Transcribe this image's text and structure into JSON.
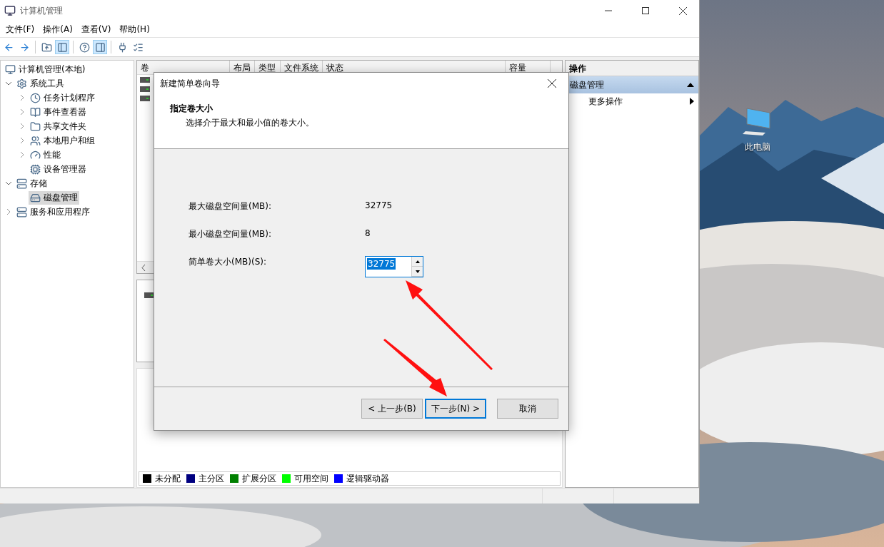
{
  "window": {
    "title": "计算机管理"
  },
  "menu": [
    "文件(F)",
    "操作(A)",
    "查看(V)",
    "帮助(H)"
  ],
  "toolbar": [
    {
      "pressed": false
    },
    {
      "pressed": false
    },
    {
      "pressed": false
    },
    {
      "pressed": true
    },
    {
      "pressed": false
    },
    {
      "pressed": true
    },
    {
      "pressed": false
    },
    {
      "pressed": false
    }
  ],
  "tree": {
    "label": "计算机管理(本地)",
    "children": [
      {
        "label": "系统工具",
        "expanded": true,
        "selected": false,
        "children": [
          {
            "label": "任务计划程序",
            "expanded": false,
            "selected": false
          },
          {
            "label": "事件查看器",
            "expanded": false,
            "selected": false
          },
          {
            "label": "共享文件夹",
            "expanded": false,
            "selected": false
          },
          {
            "label": "本地用户和组",
            "expanded": false,
            "selected": false
          },
          {
            "label": "性能",
            "expanded": false,
            "selected": false
          },
          {
            "label": "设备管理器",
            "selected": false
          }
        ]
      },
      {
        "label": "存储",
        "expanded": true,
        "selected": false,
        "children": [
          {
            "label": "磁盘管理",
            "selected": true
          }
        ]
      },
      {
        "label": "服务和应用程序",
        "expanded": false,
        "selected": false
      }
    ]
  },
  "volume_list": {
    "columns": [
      "卷",
      "布局",
      "类型",
      "文件系统",
      "状态",
      "容量"
    ]
  },
  "legend": [
    {
      "label": "未分配",
      "color": "#000000"
    },
    {
      "label": "主分区",
      "color": "#000080"
    },
    {
      "label": "扩展分区",
      "color": "#008000"
    },
    {
      "label": "可用空间",
      "color": "#00ff00"
    },
    {
      "label": "逻辑驱动器",
      "color": "#0000ff"
    }
  ],
  "actions": {
    "title": "操作",
    "items": [
      {
        "kind": "section",
        "label": "磁盘管理",
        "expanded": true
      },
      {
        "kind": "submenu",
        "label": "更多操作"
      }
    ]
  },
  "dialog": {
    "title": "新建简单卷向导",
    "heading": "指定卷大小",
    "subtitle": "选择介于最大和最小值的卷大小。",
    "fields": [
      {
        "kind": "readout",
        "label": "最大磁盘空间量(MB):",
        "value": "32775"
      },
      {
        "kind": "readout",
        "label": "最小磁盘空间量(MB):",
        "value": "8"
      },
      {
        "kind": "spinner",
        "label": "简单卷大小(MB)(S):",
        "value": "32775",
        "text_selected": true
      }
    ],
    "buttons": [
      {
        "label": "< 上一步(B)",
        "focused": false
      },
      {
        "label": "下一步(N) >",
        "focused": true
      },
      {
        "label": "取消",
        "focused": false
      }
    ]
  },
  "desktop": {
    "icons": [
      {
        "label": "此电脑"
      }
    ]
  }
}
